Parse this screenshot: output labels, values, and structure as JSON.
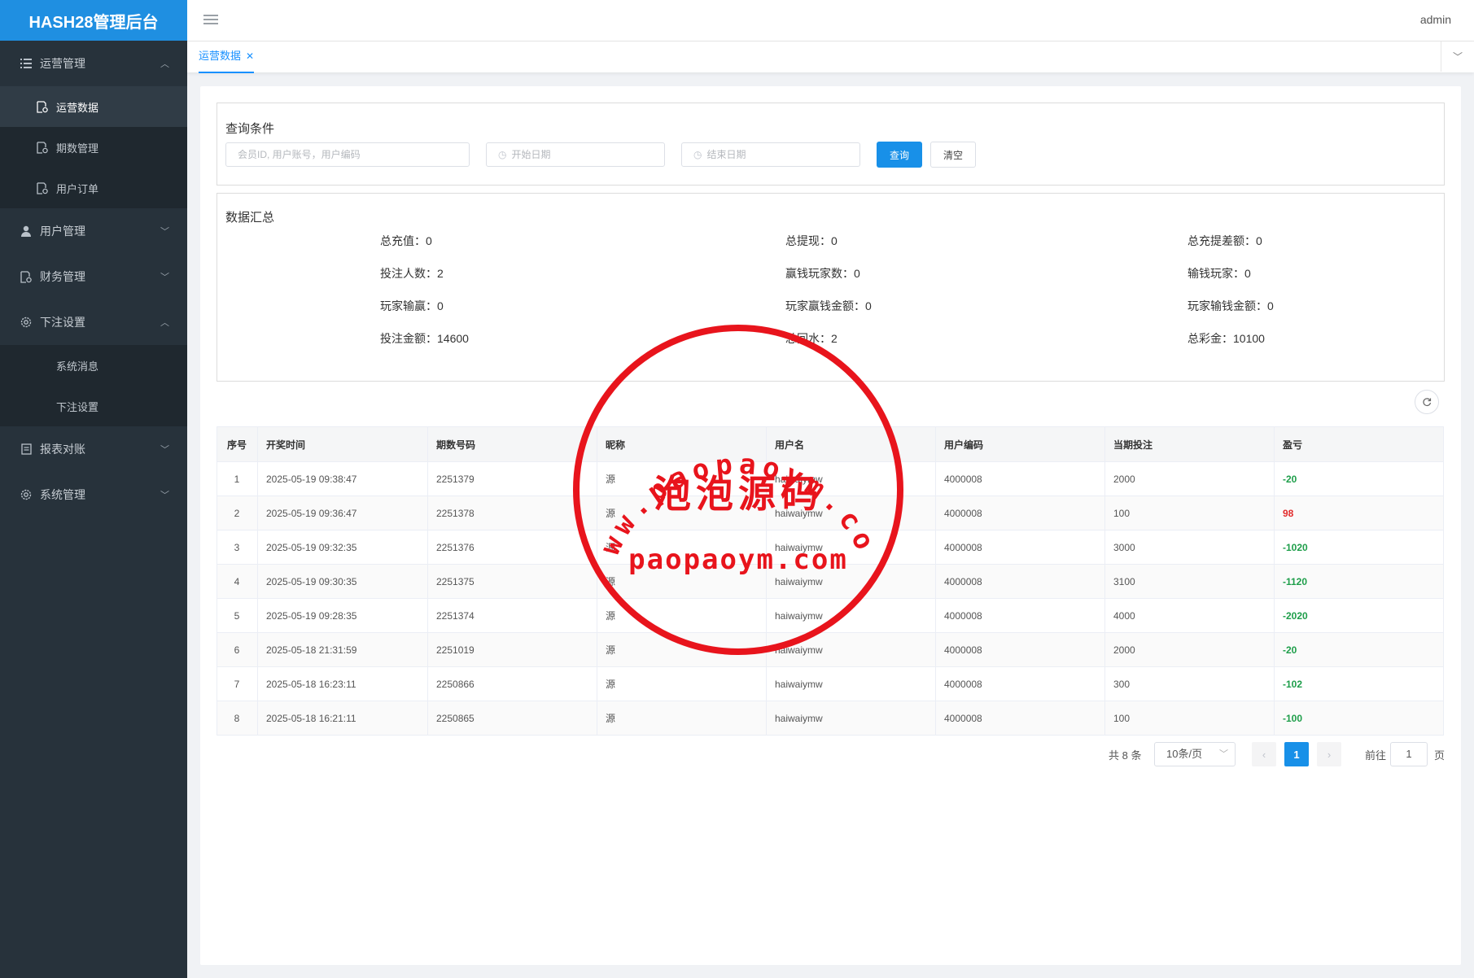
{
  "app": {
    "title": "HASH28管理后台",
    "user": "admin"
  },
  "sidebar": {
    "groups": [
      {
        "label": "运营管理",
        "expanded": true,
        "icon": "list-icon",
        "items": [
          {
            "label": "运营数据",
            "active": true,
            "icon": "doc-settings-icon"
          },
          {
            "label": "期数管理",
            "active": false,
            "icon": "doc-settings-icon"
          },
          {
            "label": "用户订单",
            "active": false,
            "icon": "doc-settings-icon"
          }
        ]
      },
      {
        "label": "用户管理",
        "expanded": false,
        "icon": "user-icon"
      },
      {
        "label": "财务管理",
        "expanded": false,
        "icon": "doc-settings-icon"
      },
      {
        "label": "下注设置",
        "expanded": true,
        "icon": "gear-icon",
        "items": [
          {
            "label": "系统消息"
          },
          {
            "label": "下注设置"
          }
        ]
      },
      {
        "label": "报表对账",
        "expanded": false,
        "icon": "report-icon"
      },
      {
        "label": "系统管理",
        "expanded": false,
        "icon": "gear-icon"
      }
    ]
  },
  "tabs": [
    {
      "label": "运营数据",
      "active": true
    }
  ],
  "query": {
    "title": "查询条件",
    "member_placeholder": "会员ID, 用户账号，用户编码",
    "start_placeholder": "开始日期",
    "end_placeholder": "结束日期",
    "search_label": "查询",
    "clear_label": "清空"
  },
  "summary": {
    "title": "数据汇总",
    "stats": [
      [
        "总充值：0",
        "总提现：0",
        "总充提差额：0"
      ],
      [
        "投注人数：2",
        "赢钱玩家数：0",
        "输钱玩家：0"
      ],
      [
        "玩家输赢：0",
        "玩家赢钱金额：0",
        "玩家输钱金额：0"
      ],
      [
        "投注金额：14600",
        "总回水：2",
        "总彩金：10100"
      ]
    ]
  },
  "table": {
    "headers": [
      "序号",
      "开奖时间",
      "期数号码",
      "昵称",
      "用户名",
      "用户编码",
      "当期投注",
      "盈亏"
    ],
    "rows": [
      [
        "1",
        "2025-05-19 09:38:47",
        "2251379",
        "源",
        "haiwaiymw",
        "4000008",
        "2000",
        "-20"
      ],
      [
        "2",
        "2025-05-19 09:36:47",
        "2251378",
        "源",
        "haiwaiymw",
        "4000008",
        "100",
        "98"
      ],
      [
        "3",
        "2025-05-19 09:32:35",
        "2251376",
        "源",
        "haiwaiymw",
        "4000008",
        "3000",
        "-1020"
      ],
      [
        "4",
        "2025-05-19 09:30:35",
        "2251375",
        "源",
        "haiwaiymw",
        "4000008",
        "3100",
        "-1120"
      ],
      [
        "5",
        "2025-05-19 09:28:35",
        "2251374",
        "源",
        "haiwaiymw",
        "4000008",
        "4000",
        "-2020"
      ],
      [
        "6",
        "2025-05-18 21:31:59",
        "2251019",
        "源",
        "haiwaiymw",
        "4000008",
        "2000",
        "-20"
      ],
      [
        "7",
        "2025-05-18 16:23:11",
        "2250866",
        "源",
        "haiwaiymw",
        "4000008",
        "300",
        "-102"
      ],
      [
        "8",
        "2025-05-18 16:21:11",
        "2250865",
        "源",
        "haiwaiymw",
        "4000008",
        "100",
        "-100"
      ]
    ]
  },
  "pagination": {
    "total": "共 8 条",
    "page_size": "10条/页",
    "current_page": "1",
    "goto_label": "前往",
    "goto_value": "1",
    "page_unit": "页"
  },
  "watermark": {
    "ring_text": "www.paopaoym.com",
    "center_text": "泡泡源码",
    "bottom_text": "paopaoym.com",
    "color": "#e8141c"
  },
  "colors": {
    "accent": "#1890e8",
    "sidebar": "#27323b",
    "positive": "#e22a2a",
    "negative": "#1e9e4a"
  }
}
